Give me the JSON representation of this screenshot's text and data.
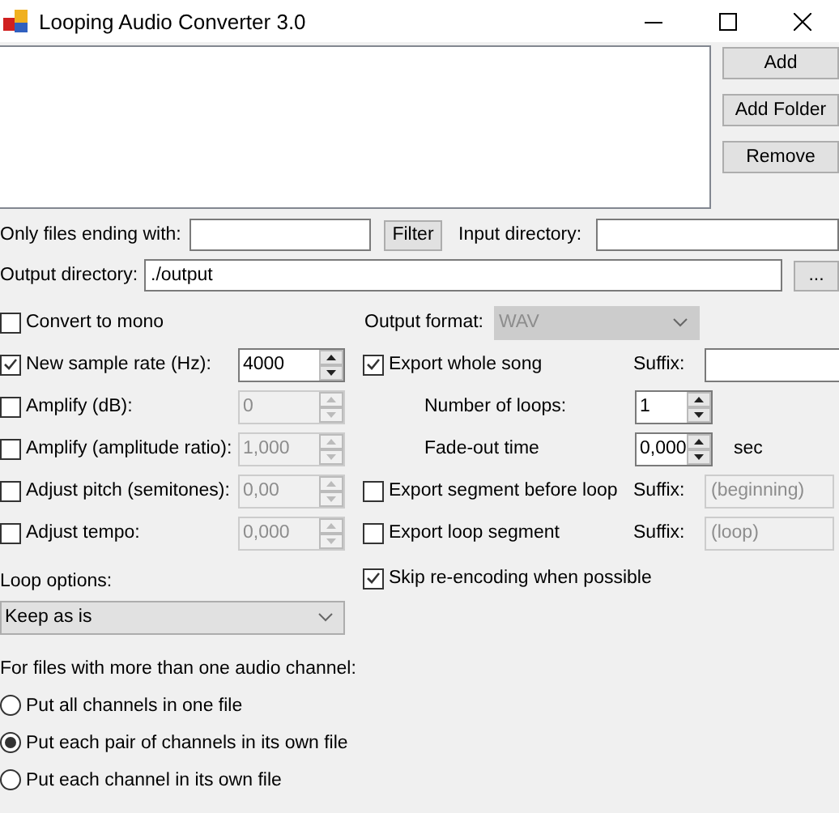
{
  "window": {
    "title": "Looping Audio Converter 3.0"
  },
  "file_buttons": [
    "Add",
    "Add Folder",
    "Remove"
  ],
  "filter": {
    "label": "Only files ending with:",
    "button": "Filter"
  },
  "input_directory": {
    "label": "Input directory:"
  },
  "output_directory": {
    "label": "Output directory:",
    "value": "./output",
    "browse_button": "..."
  },
  "options": [
    {
      "kind": "checkbox",
      "label": "Convert to mono",
      "checked": false
    },
    {
      "kind": "spinner",
      "label": "New sample rate (Hz):",
      "checked": true,
      "value": "4000"
    },
    {
      "kind": "spinner",
      "label": "Amplify (dB):",
      "checked": false,
      "value": "0"
    },
    {
      "kind": "spinner",
      "label": "Amplify (amplitude ratio):",
      "checked": false,
      "value": "1,000"
    },
    {
      "kind": "spinner",
      "label": "Adjust pitch (semitones):",
      "checked": false,
      "value": "0,00"
    },
    {
      "kind": "spinner",
      "label": "Adjust tempo:",
      "checked": false,
      "value": "0,000"
    }
  ],
  "output_format": {
    "label": "Output format:",
    "value": "WAV",
    "disabled": true
  },
  "export_whole_song": {
    "label": "Export whole song",
    "checked": true,
    "suffix_label": "Suffix:",
    "loops_label": "Number of loops:",
    "loops": "1",
    "fade_label": "Fade-out time",
    "fade": "0,000",
    "fade_unit": "sec"
  },
  "exports": [
    {
      "label": "Export segment before loop",
      "checked": false,
      "suffix_label": "Suffix:",
      "suffix": "(beginning)"
    },
    {
      "label": "Export loop segment",
      "checked": false,
      "suffix_label": "Suffix:",
      "suffix": "(loop)"
    }
  ],
  "skip_reencoding": {
    "label": "Skip re-encoding when possible",
    "checked": true
  },
  "loop_options": {
    "label": "Loop options:",
    "value": "Keep as is"
  },
  "channels": {
    "label": "For files with more than one audio channel:",
    "options": [
      {
        "label": "Put all channels in one file",
        "selected": false
      },
      {
        "label": "Put each pair of channels in its own file",
        "selected": true
      },
      {
        "label": "Put each channel in its own file",
        "selected": false
      }
    ]
  }
}
